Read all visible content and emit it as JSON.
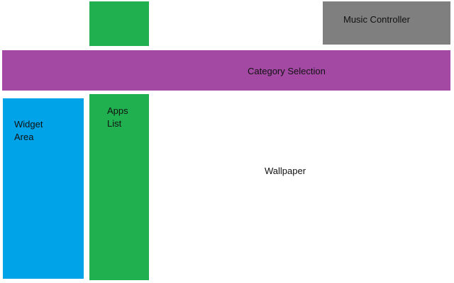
{
  "music_controller": {
    "label": "Music Controller",
    "color": "#7f7f7f"
  },
  "category_selection": {
    "label": "Category Selection",
    "color": "#a349a4"
  },
  "widget_area": {
    "label_line1": "Widget",
    "label_line2": "Area",
    "color": "#00a2e8"
  },
  "apps_list": {
    "label_line1": "Apps",
    "label_line2": "List",
    "color": "#21b04f"
  },
  "apps_top_block": {
    "color": "#21b04f"
  },
  "wallpaper": {
    "label": "Wallpaper"
  }
}
